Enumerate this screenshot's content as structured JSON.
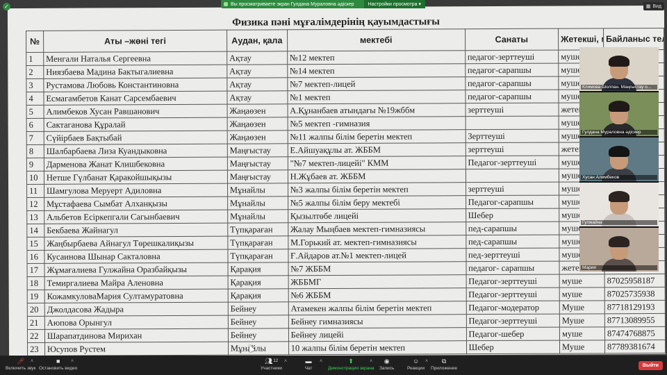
{
  "banner": {
    "text": "Вы просматриваете экран Гулдана Мураловна әдіскер",
    "options": "Настройки просмотра ▾"
  },
  "view_button": "Вид",
  "document": {
    "title": "Физика пәні мұғалімдерінің қауымдастығы",
    "columns": [
      "№",
      "Аты –жөні тегі",
      "Аудан, қала",
      "мектебі",
      "Санаты",
      "Жетекші, муше",
      "Байланыс телефоны"
    ],
    "rows": [
      [
        "1",
        "Менгали Наталья Сергеевна",
        "Ақтау",
        "№12 мектеп",
        "педагог-зерттеуші",
        "муше",
        ""
      ],
      [
        "2",
        "Ниязбаева Мадина Бактыгалиевна",
        "Ақтау",
        "№14 мектеп",
        "педагог-сарапшы",
        "муше",
        ""
      ],
      [
        "3",
        "Рустамова Любовь Константиновна",
        "Ақтау",
        "№7 мектеп-лицей",
        "педагог-сарапшы",
        "муше",
        ""
      ],
      [
        "4",
        "Есмагамбетов Канат Сарсембаевич",
        "Ақтау",
        "№1 мектеп",
        "педагог-сарапшы",
        "муше",
        ""
      ],
      [
        "5",
        "Алимбеков Хусан Равшанович",
        "Жаңаөзен",
        "А.Құнанбаев атындағы №19жббм",
        "зерттеуші",
        "жетекш",
        ""
      ],
      [
        "6",
        "Сактаганова Құралай",
        "Жаңаөзен",
        "№5 мектеп -гимназия",
        "",
        "муше",
        ""
      ],
      [
        "7",
        "Сүйірбаев Бақтыбай",
        "Жаңаөзен",
        "№11 жалпы білім беретін мектеп",
        "Зерттеуші",
        "муше",
        ""
      ],
      [
        "8",
        "Шалбарбаева Лиза Куандыковна",
        "Маңғыстау",
        "Е.Айшуақұлы ат. ЖББМ",
        "зерттеуші",
        "жетекш",
        ""
      ],
      [
        "9",
        "Дарменова Жанат Клишбековна",
        "Маңғыстау",
        "\"№7 мектеп-лицейі\" КММ",
        "Педагог-зерттеуші",
        "муше",
        ""
      ],
      [
        "10",
        "Нетше Гүлбанат Қаракойшықызы",
        "Маңғыстау",
        "Н.Жұбаев ат. ЖББМ",
        "",
        "муше",
        ""
      ],
      [
        "11",
        "Шамгулова Меруерт Адиловна",
        "Мұнайлы",
        "№3 жалпы білім беретін мектеп",
        "зерттеуші",
        "муше",
        ""
      ],
      [
        "12",
        "Мұстафаева Сымбат Алханқызы",
        "Мұнайлы",
        "№5 жалпы білім беру мектебі",
        "Педагог-сарапшы",
        "муше",
        ""
      ],
      [
        "13",
        "Альбетов Есіркепгали Сагынбаевич",
        "Мұнайлы",
        "Қызылтөбе лицейі",
        "Шебер",
        "муше",
        ""
      ],
      [
        "14",
        "Бекбаева Жайнагул",
        "Түпқараған",
        "Жалау Мыңбаев мектеп-гимназиясы",
        "пед-сарапшы",
        "муше",
        ""
      ],
      [
        "15",
        "Жаңбырбаева Айнагул Төрешкалиқызы",
        "Түпқараған",
        "М.Горький ат. мектеп-гимназиясы",
        "пед-сарапшы",
        "муше",
        ""
      ],
      [
        "16",
        "Кусаинова Шынар Сакталовна",
        "Түпқараған",
        "Ғ.Айдаров ат.№1 мектеп-лицей",
        "пед-зерттеуші",
        "муше",
        ""
      ],
      [
        "17",
        "Жұмағалиева Гулжайна Оразбайқызы",
        "Қарақия",
        "№7 ЖББМ",
        "педагог- сарапшы",
        "жетекш",
        ""
      ],
      [
        "18",
        "Темиргалиева Майра Аленовна",
        "Қарақия",
        "ЖББМГ",
        "Педагог-зерттеуші",
        "муше",
        "87025958187"
      ],
      [
        "19",
        "КожамкуловаМария Султамуратовна",
        "Қарақия",
        "№6 ЖББМ",
        "Педагог-зерттеуші",
        "муше",
        "87025735938"
      ],
      [
        "20",
        "Джолдасова Жадыра",
        "Бейнеу",
        "Атамекен жалпы білім беретін мектеп",
        "Педагог-модератор",
        "Муше",
        "87718129193"
      ],
      [
        "21",
        "Аюпова Орынгул",
        "Бейнеу",
        "Бейнеу гимназиясы",
        "Педагог-зерттеуші",
        "Муше",
        "87713089955"
      ],
      [
        "22",
        "Шарапатдинова Мирихан",
        "Бейнеу",
        "Бейнеу лицейі",
        "Педагог-шебер",
        "муше",
        "87474768875"
      ],
      [
        "23",
        "Юсупов Рустем",
        "Мұнайлы",
        "10 жалпы білім беретін мектеп",
        "Шебер",
        "Муше",
        "87789381674"
      ]
    ]
  },
  "participants": [
    {
      "name": "Климова Шолпан. Маңғыстау о...",
      "bg": "#d9d3c8",
      "torso": "#2f3340",
      "hair": "#1f1a18",
      "active": false
    },
    {
      "name": "Гулдана Мураловна әдіскер",
      "bg": "#7b8f5a",
      "torso": "#2a2a2a",
      "hair": "#1f1a18",
      "active": true
    },
    {
      "name": "Хусан Алимбеков",
      "bg": "#5f7a84",
      "torso": "#3b3f45",
      "hair": "#141414",
      "active": false
    },
    {
      "name": "Гулжайна",
      "bg": "#e8e4e0",
      "torso": "#c9c2bd",
      "hair": "#2c2420",
      "active": false
    },
    {
      "name": "Мария",
      "bg": "#b8a99a",
      "torso": "#5a4f4a",
      "hair": "#2b2320",
      "active": false
    }
  ],
  "toolbar": {
    "mute": "Включить звук",
    "video": "Остановить видео",
    "participants": "Участники",
    "participants_count": "12",
    "chat": "Чат",
    "share": "Демонстрация экрана",
    "record": "Запись",
    "reactions": "Реакции",
    "apps": "Приложение",
    "leave": "Выйти"
  }
}
